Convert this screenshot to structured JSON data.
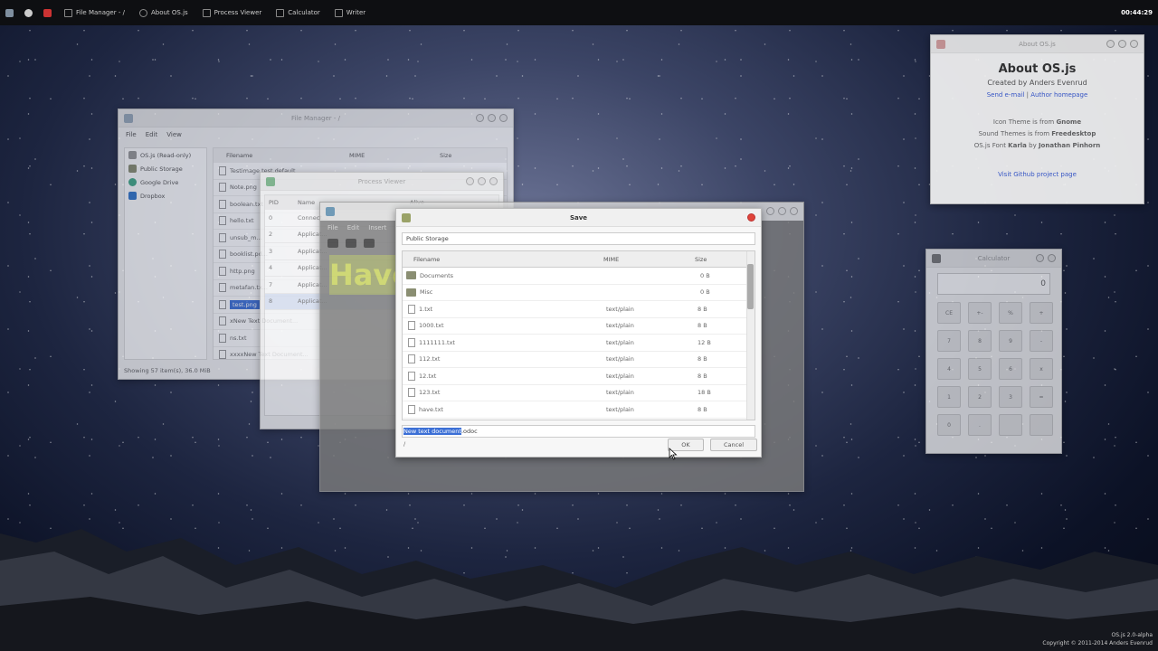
{
  "panel": {
    "tasks": [
      "File Manager - /",
      "About OS.js",
      "Process Viewer",
      "Calculator",
      "Writer"
    ],
    "clock": "00:44:29"
  },
  "file_manager": {
    "title": "File Manager - /",
    "menu": [
      "File",
      "Edit",
      "View"
    ],
    "sidebar": [
      "OS.js (Read-only)",
      "Public Storage",
      "Google Drive",
      "Dropbox"
    ],
    "columns": [
      "Filename",
      "MIME",
      "Size"
    ],
    "status": "Showing 57 item(s), 36.0 MiB",
    "selected_file": "test.png",
    "files": [
      "Testimage.test.default",
      "Note.png",
      "boolean.txt",
      "hello.txt",
      "unsub_m...",
      "booklist.pd...",
      "http.png",
      "metafan.tx...",
      "test.png",
      "xNew Text Document...",
      "ns.txt",
      "xxxxNew Text Document..."
    ]
  },
  "process_viewer": {
    "title": "Process Viewer",
    "columns": [
      "PID",
      "Name",
      "Alive"
    ],
    "rows": [
      {
        "pid": "0",
        "name": "Connect..."
      },
      {
        "pid": "2",
        "name": "Applicat..."
      },
      {
        "pid": "3",
        "name": "Applicat..."
      },
      {
        "pid": "4",
        "name": "Applicat..."
      },
      {
        "pid": "7",
        "name": "Applicat..."
      },
      {
        "pid": "8",
        "name": "Applicat..."
      }
    ]
  },
  "writer": {
    "menu": [
      "File",
      "Edit",
      "Insert"
    ],
    "preview_text": "Have"
  },
  "save_dialog": {
    "title": "Save",
    "path": "Public Storage",
    "columns": [
      "Filename",
      "MIME",
      "Size"
    ],
    "rows": [
      {
        "name": "Documents",
        "mime": "",
        "size": "0 B",
        "kind": "folder"
      },
      {
        "name": "Misc",
        "mime": "",
        "size": "0 B",
        "kind": "folder"
      },
      {
        "name": "1.txt",
        "mime": "text/plain",
        "size": "8 B",
        "kind": "file"
      },
      {
        "name": "1000.txt",
        "mime": "text/plain",
        "size": "8 B",
        "kind": "file"
      },
      {
        "name": "1111111.txt",
        "mime": "text/plain",
        "size": "12 B",
        "kind": "file"
      },
      {
        "name": "112.txt",
        "mime": "text/plain",
        "size": "8 B",
        "kind": "file"
      },
      {
        "name": "12.txt",
        "mime": "text/plain",
        "size": "8 B",
        "kind": "file"
      },
      {
        "name": "123.txt",
        "mime": "text/plain",
        "size": "18 B",
        "kind": "file"
      },
      {
        "name": "have.txt",
        "mime": "text/plain",
        "size": "8 B",
        "kind": "file"
      }
    ],
    "filename_selected": "New text document",
    "filename_rest": ".odoc",
    "status": "/",
    "ok_label": "OK",
    "cancel_label": "Cancel"
  },
  "about": {
    "window_title": "About OS.js",
    "heading": "About OS.js",
    "created_by": "Created by Anders Evenrud",
    "link_email": "Send e-mail",
    "link_sep": " | ",
    "link_home": "Author homepage",
    "credits": [
      {
        "pre": "Icon Theme is from ",
        "name": "Gnome"
      },
      {
        "pre": "Sound Themes is from ",
        "name": "Freedesktop"
      },
      {
        "pre": "OS.js Font ",
        "name": "Karla",
        "post": " by ",
        "name2": "Jonathan Pinhorn"
      }
    ],
    "github": "Visit Github project page"
  },
  "calculator": {
    "title": "Calculator",
    "display": "0",
    "keys": [
      "CE",
      "+-",
      "%",
      "+",
      "7",
      "8",
      "9",
      "-",
      "4",
      "5",
      "6",
      "x",
      "1",
      "2",
      "3",
      "=",
      "0",
      ".",
      "",
      ""
    ]
  },
  "footer": {
    "version": "OS.js 2.0-alpha",
    "copyright": "Copyright © 2011-2014 Anders Evenrud"
  },
  "colors": {
    "accent": "#3b6fd6",
    "close": "#e0443a",
    "panel": "#0e0f12"
  }
}
